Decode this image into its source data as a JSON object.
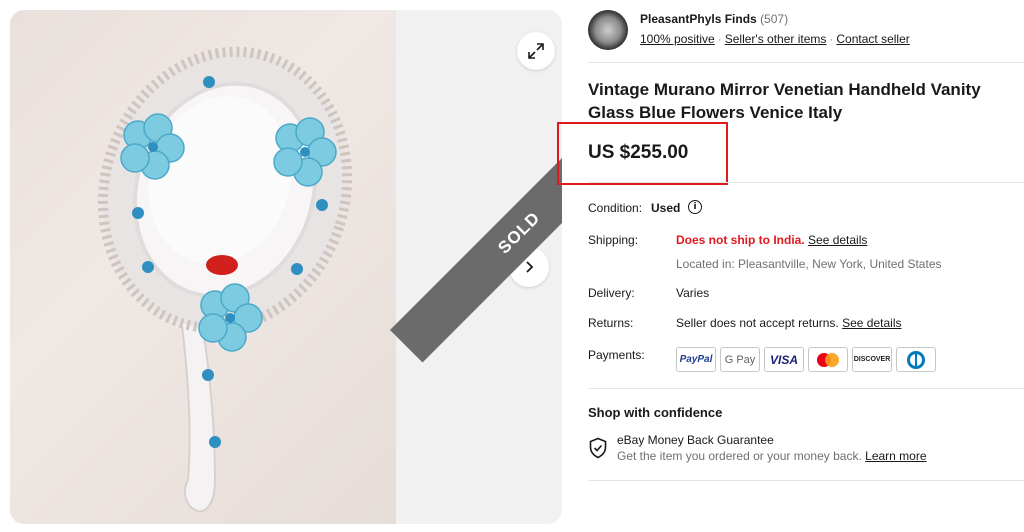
{
  "gallery": {
    "sold_label": "SOLD",
    "expand_icon": "expand-icon",
    "next_icon": "chevron-right-icon",
    "photo_badge_logo": "seal-logo"
  },
  "seller": {
    "name": "PleasantPhyls Finds",
    "feedback_count": "(507)",
    "positive": "100% positive",
    "other_items": "Seller's other items",
    "contact": "Contact seller"
  },
  "listing": {
    "title": "Vintage Murano Mirror Venetian Handheld Vanity Glass Blue Flowers Venice Italy",
    "price": "US $255.00",
    "highlight_color": "#e0191f"
  },
  "details": {
    "condition_label": "Condition:",
    "condition_value": "Used",
    "shipping_label": "Shipping:",
    "shipping_value": "Does not ship to India.",
    "shipping_link": "See details",
    "location": "Located in: Pleasantville, New York, United States",
    "delivery_label": "Delivery:",
    "delivery_value": "Varies",
    "returns_label": "Returns:",
    "returns_value": "Seller does not accept returns.",
    "returns_link": "See details",
    "payments_label": "Payments:",
    "payment_methods": [
      "PayPal",
      "G Pay",
      "VISA",
      "Mastercard",
      "DISCOVER",
      "Diners Club"
    ]
  },
  "confidence": {
    "title": "Shop with confidence",
    "guarantee_title": "eBay Money Back Guarantee",
    "guarantee_text": "Get the item you ordered or your money back.",
    "learn_more": "Learn more"
  }
}
